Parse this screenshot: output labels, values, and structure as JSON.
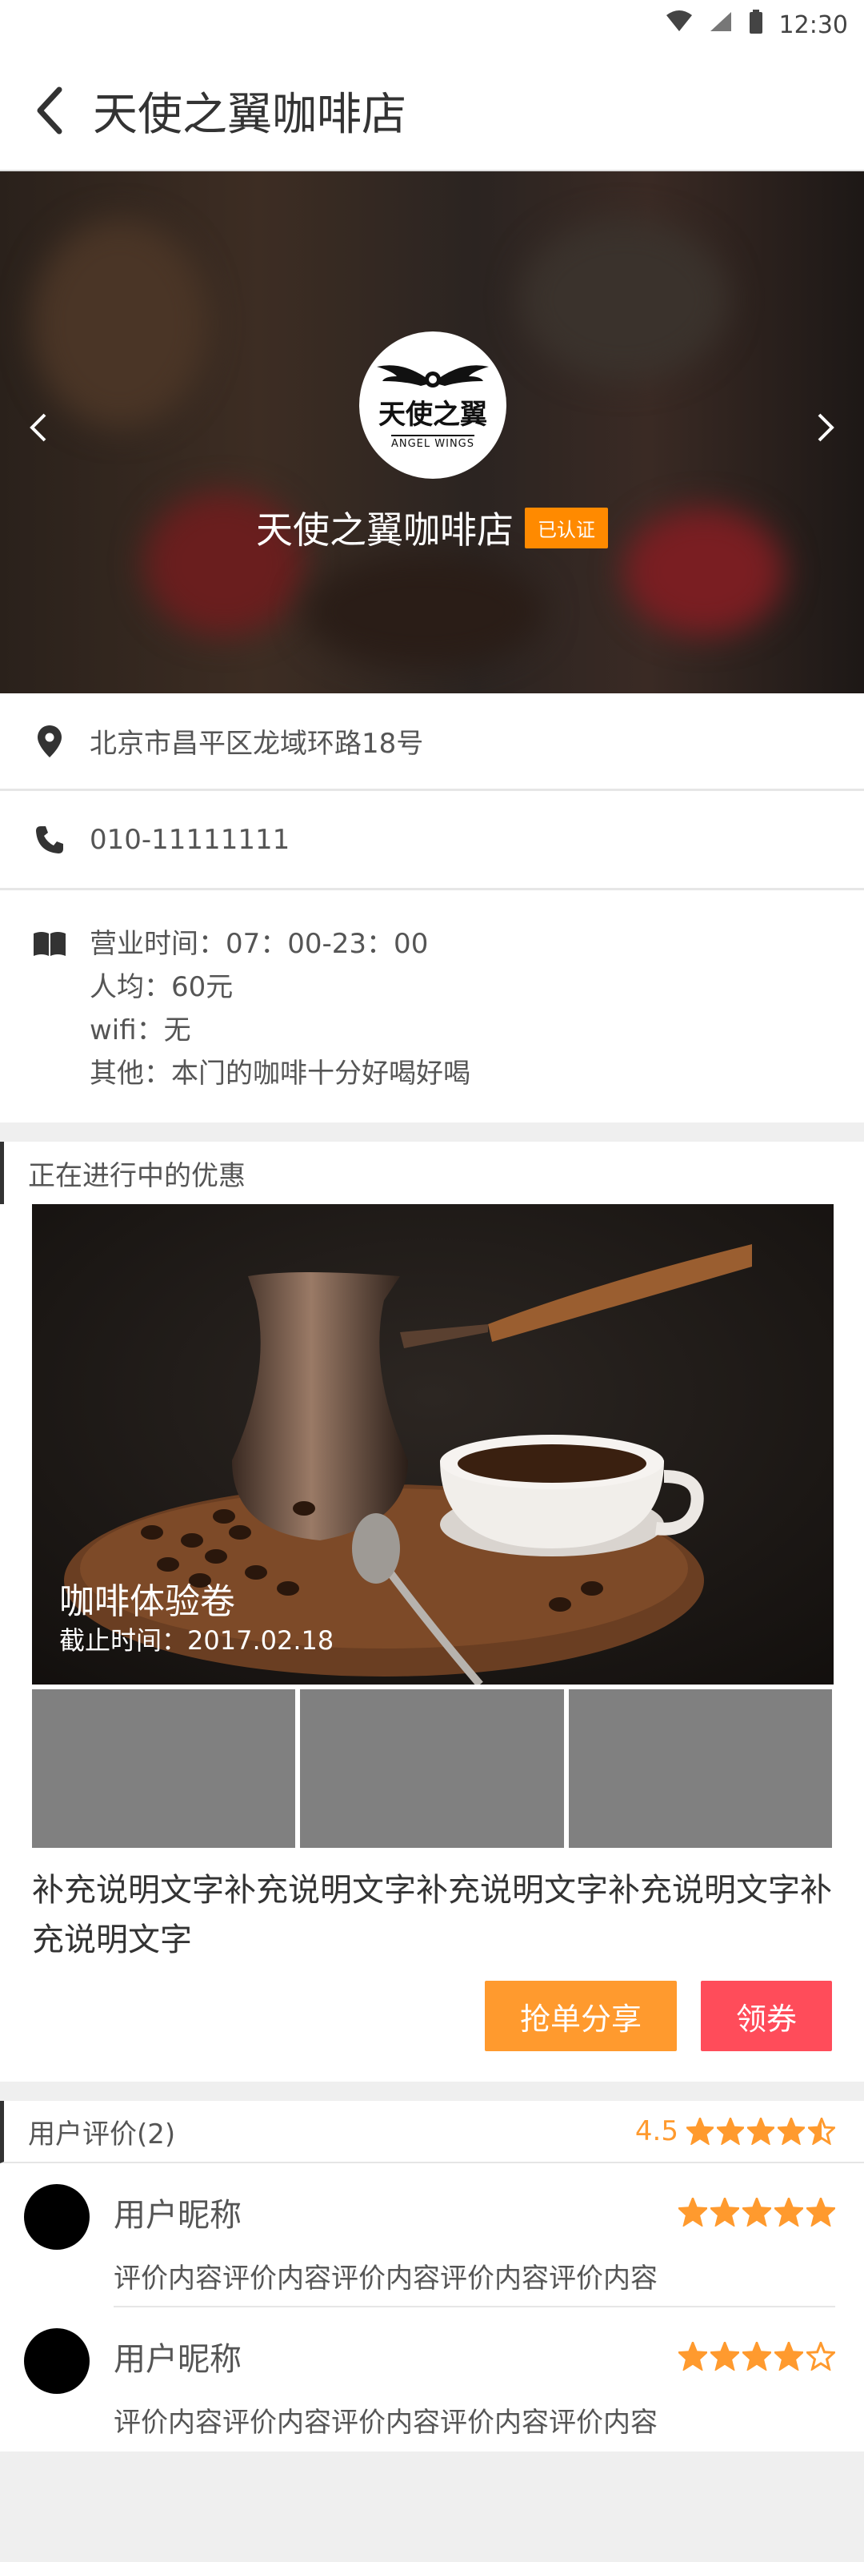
{
  "status_bar": {
    "time": "12:30"
  },
  "app_bar": {
    "title": "天使之翼咖啡店"
  },
  "hero": {
    "logo_cn": "天使之翼",
    "logo_en": "ANGEL WINGS",
    "shop_name": "天使之翼咖啡店",
    "badge": "已认证"
  },
  "info": {
    "address": "北京市昌平区龙域环路18号",
    "phone": "010-11111111",
    "hours": "营业时间：07：00-23：00",
    "avg_price": "人均：60元",
    "wifi": "wifi：无",
    "other": "其他：本门的咖啡十分好喝好喝"
  },
  "promo": {
    "section_title": "正在进行中的优惠",
    "title": "咖啡体验卷",
    "deadline": "截止时间：2017.02.18",
    "description": "补充说明文字补充说明文字补充说明文字补充说明文字补充说明文字",
    "share_button": "抢单分享",
    "coupon_button": "领券"
  },
  "reviews": {
    "section_title": "用户评价(2)",
    "score": "4.5",
    "score_stars": 4.5,
    "items": [
      {
        "nickname": "用户昵称",
        "stars": 5,
        "content": "评价内容评价内容评价内容评价内容评价内容"
      },
      {
        "nickname": "用户昵称",
        "stars": 4,
        "content": "评价内容评价内容评价内容评价内容评价内容"
      }
    ]
  },
  "colors": {
    "accent_orange": "#ff9a2e",
    "badge_orange": "#ff8a00",
    "coupon_red": "#ff4c5a"
  }
}
